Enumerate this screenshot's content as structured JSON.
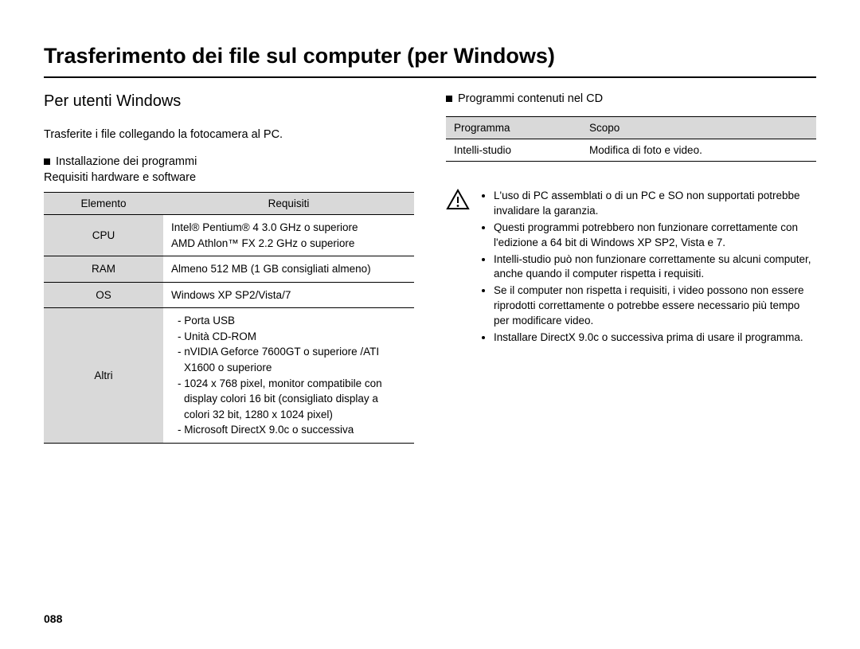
{
  "page_number": "088",
  "title": "Trasferimento dei file sul computer (per Windows)",
  "left": {
    "subtitle": "Per utenti Windows",
    "lead": "Trasferite i file collegando la fotocamera al PC.",
    "install_heading": "Installazione dei programmi",
    "install_sub": "Requisiti hardware e software",
    "table": {
      "header_elemento": "Elemento",
      "header_requisiti": "Requisiti",
      "rows": {
        "cpu_label": "CPU",
        "cpu_val": "Intel® Pentium® 4 3.0 GHz o superiore\nAMD Athlon™ FX 2.2 GHz o superiore",
        "ram_label": "RAM",
        "ram_val": "Almeno 512 MB (1 GB consigliati almeno)",
        "os_label": "OS",
        "os_val": "Windows XP SP2/Vista/7",
        "altri_label": "Altri",
        "altri_items": [
          "- Porta USB",
          "- Unità CD-ROM",
          "- nVIDIA Geforce 7600GT o superiore /ATI X1600 o superiore",
          "- 1024 x 768 pixel, monitor compatibile con display colori 16 bit (consigliato display a colori 32 bit, 1280 x 1024 pixel)",
          "- Microsoft DirectX 9.0c o successiva"
        ]
      }
    }
  },
  "right": {
    "cd_heading": "Programmi contenuti nel CD",
    "prog_table": {
      "header_program": "Programma",
      "header_scope": "Scopo",
      "row_program": "Intelli-studio",
      "row_scope": "Modifica di foto e video."
    },
    "warnings": [
      "L'uso di PC assemblati o di un PC e SO non supportati potrebbe invalidare la garanzia.",
      "Questi programmi potrebbero non funzionare correttamente con l'edizione a 64 bit di Windows XP SP2, Vista e 7.",
      "Intelli-studio può non funzionare correttamente su alcuni computer, anche quando il computer rispetta i requisiti.",
      "Se il computer non rispetta i requisiti, i video possono non essere riprodotti correttamente o potrebbe essere necessario più tempo per modificare video.",
      "Installare DirectX 9.0c o successiva prima di usare il programma."
    ]
  }
}
